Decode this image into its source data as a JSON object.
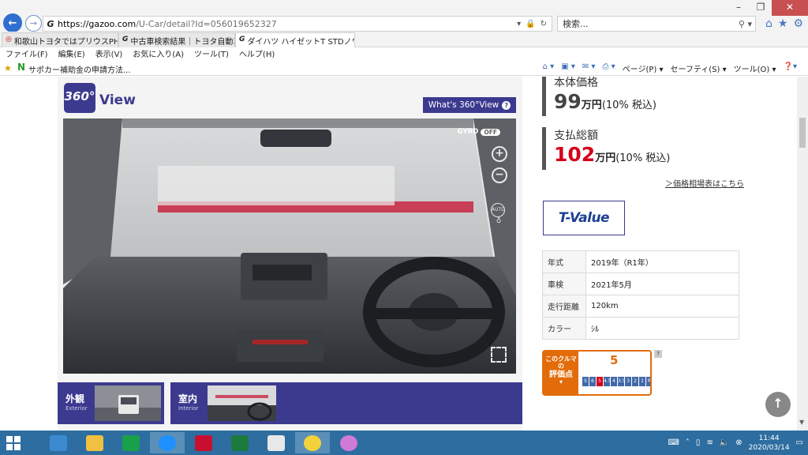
{
  "browser": {
    "url_host": "https://gazoo.com",
    "url_path": "/U-Car/detail?Id=056019652327",
    "search_placeholder": "検索...",
    "tabs": [
      {
        "label": "和歌山トヨタではプリウスPHVの展..."
      },
      {
        "label": "中古車検索結果｜トヨタ自動車..."
      },
      {
        "label": "ダイハツ ハイゼットT STDノウ..."
      }
    ],
    "menu": [
      "ファイル(F)",
      "編集(E)",
      "表示(V)",
      "お気に入り(A)",
      "ツール(T)",
      "ヘルプ(H)"
    ],
    "favorite": "サポカー補助金の申請方法...",
    "commands": [
      "ページ(P) ▾",
      "セーフティ(S) ▾",
      "ツール(O) ▾"
    ]
  },
  "viewer": {
    "logo": "360°",
    "title": "View",
    "whats_label": "What's 360°View",
    "gyro_label": "GYRO",
    "gyro_state": "OFF",
    "auto_label": "AUTO",
    "thumbs": [
      {
        "title": "外観",
        "sub": "Exterior"
      },
      {
        "title": "室内",
        "sub": "Interior"
      }
    ]
  },
  "price": {
    "base_label": "本体価格",
    "base_value": "99",
    "total_label": "支払総額",
    "total_value": "102",
    "unit": "万円",
    "tax": "(10% 税込)",
    "link": "＞価格相場表はこちら"
  },
  "tvalue_label": "T-Value",
  "specs": [
    {
      "key": "年式",
      "value": "2019年（R1年）"
    },
    {
      "key": "車検",
      "value": "2021年5月"
    },
    {
      "key": "走行距離",
      "value": "120km"
    },
    {
      "key": "カラー",
      "value": "ｼﾙ"
    }
  ],
  "rating": {
    "label_1": "このクルマの",
    "label_2": "評価点",
    "score": "5",
    "scale": [
      "S",
      "6",
      "5",
      "4.5",
      "4",
      "3.5",
      "3",
      "2",
      "1",
      "R",
      "RA"
    ],
    "highlight": "5"
  },
  "taskbar": {
    "time": "11:44",
    "date": "2020/03/14"
  }
}
